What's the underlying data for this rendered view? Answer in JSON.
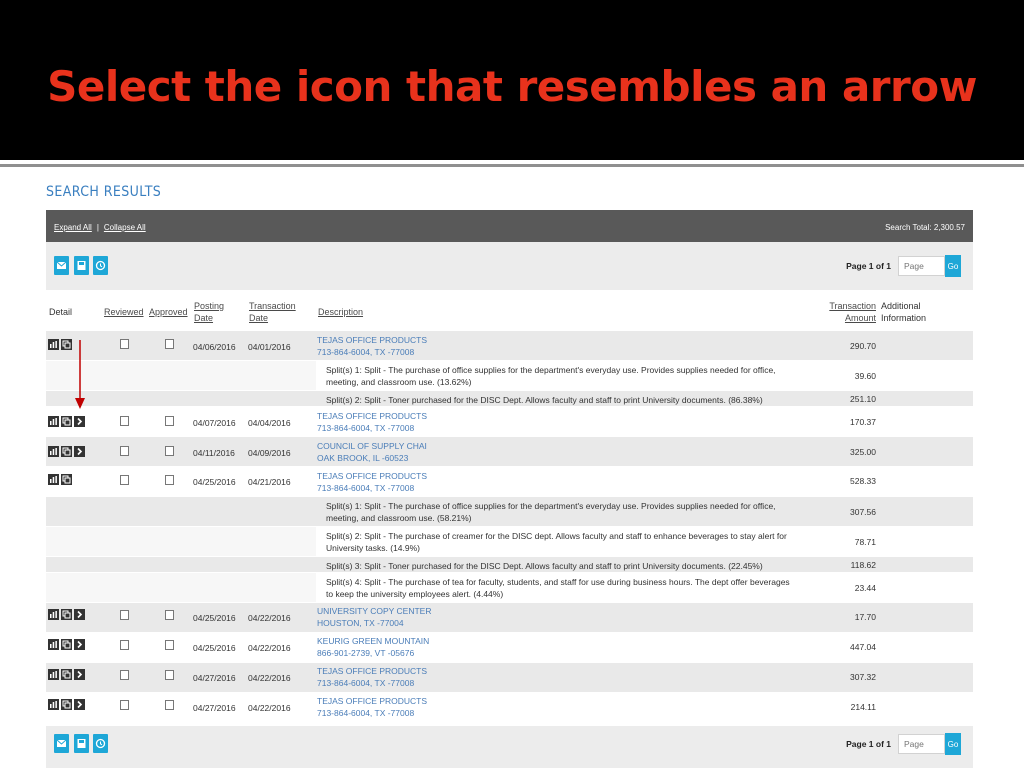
{
  "banner": {
    "title": "Select the icon that resembles an arrow"
  },
  "section_title": "SEARCH RESULTS",
  "header": {
    "expand_all": "Expand All",
    "collapse_all": "Collapse All",
    "separator": "|",
    "search_total": "Search Total: 2,300.57"
  },
  "toolbar": {
    "page_info": "Page 1 of 1",
    "page_placeholder": "Page",
    "go_label": "Go"
  },
  "columns": {
    "detail": "Detail",
    "reviewed": "Reviewed",
    "approved": "Approved",
    "posting_date_1": "Posting",
    "posting_date_2": "Date",
    "transaction_date_1": "Transaction",
    "transaction_date_2": "Date",
    "description": "Description",
    "transaction_amount_1": "Transaction",
    "transaction_amount_2": "Amount",
    "additional_info_1": "Additional",
    "additional_info_2": "Information"
  },
  "transactions": [
    {
      "posting": "04/06/2016",
      "transaction": "04/01/2016",
      "merchant": "TEJAS OFFICE PRODUCTS",
      "location": "713-864-6004, TX -77008",
      "amount": "290.70",
      "has_arrow": false
    },
    {
      "posting": "04/07/2016",
      "transaction": "04/04/2016",
      "merchant": "TEJAS OFFICE PRODUCTS",
      "location": "713-864-6004, TX -77008",
      "amount": "170.37",
      "has_arrow": true
    },
    {
      "posting": "04/11/2016",
      "transaction": "04/09/2016",
      "merchant": "COUNCIL OF SUPPLY CHAI",
      "location": "OAK BROOK, IL -60523",
      "amount": "325.00",
      "has_arrow": true
    },
    {
      "posting": "04/25/2016",
      "transaction": "04/21/2016",
      "merchant": "TEJAS OFFICE PRODUCTS",
      "location": "713-864-6004, TX -77008",
      "amount": "528.33",
      "has_arrow": false
    },
    {
      "posting": "04/25/2016",
      "transaction": "04/22/2016",
      "merchant": "UNIVERSITY COPY CENTER",
      "location": "HOUSTON, TX -77004",
      "amount": "17.70",
      "has_arrow": true
    },
    {
      "posting": "04/25/2016",
      "transaction": "04/22/2016",
      "merchant": "KEURIG GREEN MOUNTAIN",
      "location": "866-901-2739, VT -05676",
      "amount": "447.04",
      "has_arrow": true
    },
    {
      "posting": "04/27/2016",
      "transaction": "04/22/2016",
      "merchant": "TEJAS OFFICE PRODUCTS",
      "location": "713-864-6004, TX -77008",
      "amount": "307.32",
      "has_arrow": true
    },
    {
      "posting": "04/27/2016",
      "transaction": "04/22/2016",
      "merchant": "TEJAS OFFICE PRODUCTS",
      "location": "713-864-6004, TX -77008",
      "amount": "214.11",
      "has_arrow": true
    }
  ],
  "splits": [
    {
      "line1": "Split(s) 1:  Split - The purchase of office supplies for the department's everyday use. Provides supplies needed for office,",
      "line2": "meeting, and classroom use. (13.62%)",
      "amount": "39.60"
    },
    {
      "line1": "Split(s) 2:  Split - Toner purchased for the DISC Dept. Allows faculty and staff to print University documents. (86.38%)",
      "line2": "",
      "amount": "251.10"
    },
    {
      "line1": "Split(s) 1:  Split - The purchase of office supplies for the department's everyday use. Provides supplies needed for office,",
      "line2": "meeting, and classroom use. (58.21%)",
      "amount": "307.56"
    },
    {
      "line1": "Split(s) 2:  Split - The purchase of creamer for the DISC dept. Allows faculty and staff to enhance beverages to stay alert for",
      "line2": "University tasks. (14.9%)",
      "amount": "78.71"
    },
    {
      "line1": "Split(s) 3:  Split - Toner purchased for the DISC Dept. Allows faculty and staff to print University documents. (22.45%)",
      "line2": "",
      "amount": "118.62"
    },
    {
      "line1": "Split(s) 4:  Split - The purchase of tea for faculty, students, and staff for use during business hours. The dept offer beverages",
      "line2": "to keep the university employees alert. (4.44%)",
      "amount": "23.44"
    }
  ],
  "icon_names": [
    "email-icon",
    "save-icon",
    "history-icon",
    "chart-icon",
    "copy-icon",
    "arrow-right-icon"
  ],
  "colors": {
    "accent": "#1ea7d7",
    "title": "#e8321c",
    "link": "#4a7db8",
    "annotation_arrow": "#c00000"
  }
}
